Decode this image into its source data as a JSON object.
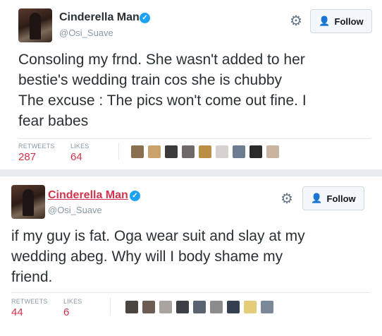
{
  "tweets": [
    {
      "name": "Cinderella Man",
      "handle": "@Osi_Suave",
      "follow_label": "Follow",
      "text_lines": [
        "Consoling my frnd. She wasn't added to her",
        "bestie's wedding train cos she is chubby",
        "The excuse : The pics won't come out fine. I",
        "fear babes"
      ],
      "retweets_label": "RETWEETS",
      "retweets": "287",
      "likes_label": "LIKES",
      "likes": "64",
      "liker_colors": [
        "#8a6f4e",
        "#c9a36b",
        "#3d3a3a",
        "#6f6a67",
        "#b98f46",
        "#d7d2cf",
        "#6d7c8e",
        "#2a2a2a",
        "#c9b4a0"
      ]
    },
    {
      "name": "Cinderella Man",
      "handle": "@Osi_Suave",
      "follow_label": "Follow",
      "text_lines": [
        "if my guy is fat. Oga wear suit and slay at my",
        "wedding abeg. Why will I body shame my",
        "friend."
      ],
      "retweets_label": "RETWEETS",
      "retweets": "44",
      "likes_label": "LIKES",
      "likes": "6",
      "liker_colors": [
        "#4a4540",
        "#6b5d52",
        "#a8a4a0",
        "#3b3f46",
        "#5a6470",
        "#8c8c8c",
        "#34404f",
        "#e3cc7a",
        "#7b8899"
      ]
    }
  ],
  "colors": {
    "count_color": "#d2334c",
    "verified_blue": "#1da1f2",
    "name_link_color": "#d2334c"
  },
  "icons": [
    "verified-badge-icon",
    "gear-icon",
    "follow-person-icon"
  ]
}
